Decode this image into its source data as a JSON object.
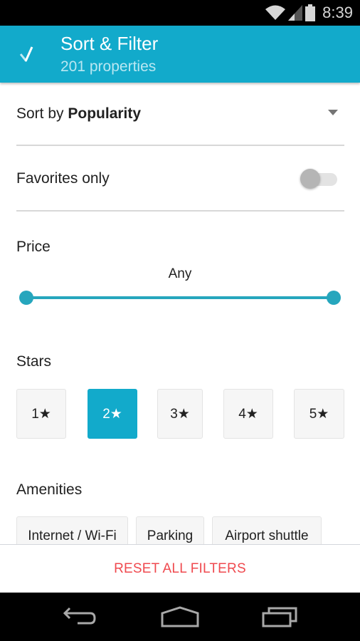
{
  "status_bar": {
    "time": "8:39",
    "icons": [
      "wifi-icon",
      "signal-icon",
      "battery-icon"
    ]
  },
  "app_bar": {
    "icon": "checkmark-icon",
    "title": "Sort & Filter",
    "subtitle": "201 properties",
    "color": "#12aacb"
  },
  "sort": {
    "prefix": "Sort by",
    "value": "Popularity",
    "icon": "dropdown-caret-icon"
  },
  "favorites": {
    "label": "Favorites only",
    "enabled": false
  },
  "price": {
    "label": "Price",
    "value_label": "Any",
    "range": {
      "min_fraction": 0.0,
      "max_fraction": 1.0
    },
    "accent_color": "#26a6bd"
  },
  "stars": {
    "label": "Stars",
    "options": [
      {
        "label": "1★",
        "selected": false
      },
      {
        "label": "2★",
        "selected": true
      },
      {
        "label": "3★",
        "selected": false
      },
      {
        "label": "4★",
        "selected": false
      },
      {
        "label": "5★",
        "selected": false
      }
    ]
  },
  "amenities": {
    "label": "Amenities",
    "options": [
      {
        "label": "Internet / Wi-Fi"
      },
      {
        "label": "Parking"
      },
      {
        "label": "Airport shuttle"
      }
    ]
  },
  "footer": {
    "reset_label": "RESET ALL FILTERS",
    "reset_color": "#ef4a4f"
  },
  "nav_bar": {
    "buttons": [
      "back-icon",
      "home-icon",
      "recents-icon"
    ]
  }
}
